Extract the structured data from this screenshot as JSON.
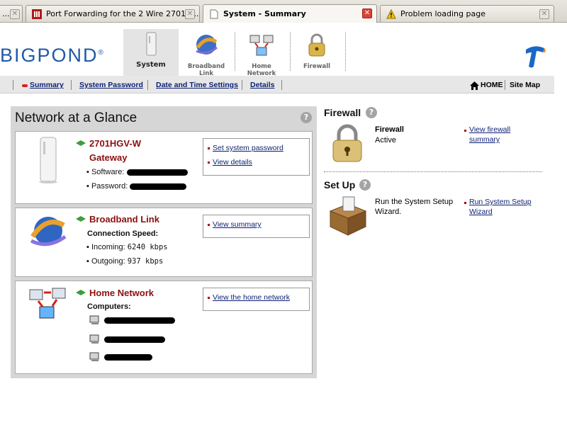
{
  "browser": {
    "tabs": [
      {
        "label": "..."
      },
      {
        "label": "Port Forwarding for the 2 Wire 2701H..."
      },
      {
        "label": "System - Summary"
      },
      {
        "label": "Problem loading page"
      }
    ]
  },
  "header": {
    "logo": "BIGPOND",
    "logo_reg": "®",
    "nav": [
      {
        "label": "System"
      },
      {
        "label": "Broadband Link"
      },
      {
        "label": "Home Network"
      },
      {
        "label": "Firewall"
      }
    ]
  },
  "subnav": {
    "items": [
      {
        "label": "Summary"
      },
      {
        "label": "System Password"
      },
      {
        "label": "Date and Time Settings"
      },
      {
        "label": "Details"
      }
    ],
    "home": "HOME",
    "sitemap": "Site Map"
  },
  "glance": {
    "title": "Network at a Glance",
    "help": "?",
    "gateway": {
      "name": "2701HGV-W",
      "subtitle": "Gateway",
      "software_label": "Software:",
      "password_label": "Password:",
      "links": [
        "Set system password",
        "View details"
      ]
    },
    "broadband": {
      "title": "Broadband Link",
      "speed_label": "Connection Speed:",
      "incoming_label": "Incoming:",
      "incoming_value": "6240 kbps",
      "outgoing_label": "Outgoing:",
      "outgoing_value": "937 kbps",
      "links": [
        "View summary"
      ]
    },
    "home": {
      "title": "Home Network",
      "computers_label": "Computers:",
      "links": [
        "View the home network"
      ]
    }
  },
  "side": {
    "firewall": {
      "heading": "Firewall",
      "label": "Firewall",
      "status": "Active",
      "link_line1": "View firewall",
      "link_line2": "summary"
    },
    "setup": {
      "heading": "Set Up",
      "text_line1": "Run the System Setup",
      "text_line2": "Wizard.",
      "link_line1": "Run System Setup",
      "link_line2": "Wizard"
    }
  },
  "colors": {
    "accent_blue": "#1f5aa8",
    "link_blue": "#0b1f73",
    "title_red": "#8b1010",
    "panel_gray": "#d6d6d6"
  }
}
